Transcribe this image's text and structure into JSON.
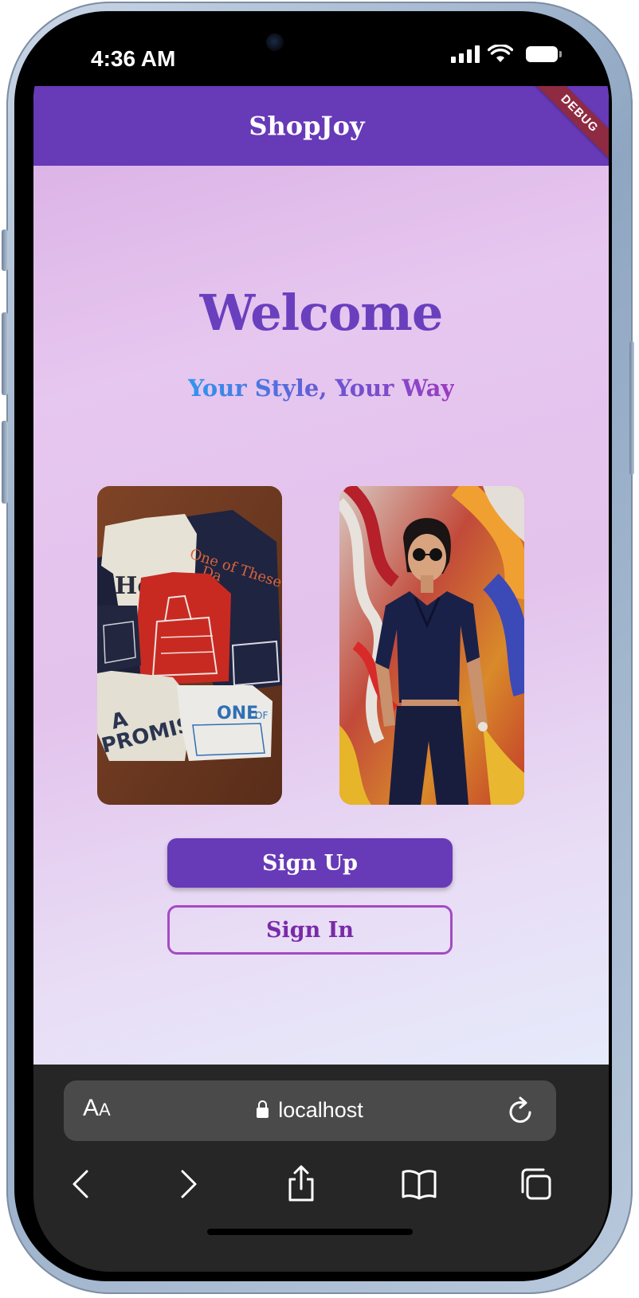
{
  "status_bar": {
    "time": "4:36 AM"
  },
  "app": {
    "title": "ShopJoy",
    "debug_banner": "DEBUG",
    "heading": "Welcome",
    "tagline": "Your Style, Your Way",
    "images": [
      {
        "name": "folded-tshirts-image"
      },
      {
        "name": "woman-graffiti-image"
      }
    ],
    "buttons": {
      "sign_up": "Sign Up",
      "sign_in": "Sign In"
    },
    "colors": {
      "primary": "#673ab7",
      "outline": "#a44ac4",
      "tagline_gradient": [
        "#2f96f0",
        "#6a55d3",
        "#9b3bc0"
      ]
    }
  },
  "browser": {
    "text_size_label": "AA",
    "url": "localhost",
    "icons": [
      "lock-icon",
      "reload-icon",
      "back-icon",
      "forward-icon",
      "share-icon",
      "bookmarks-icon",
      "tabs-icon"
    ]
  }
}
